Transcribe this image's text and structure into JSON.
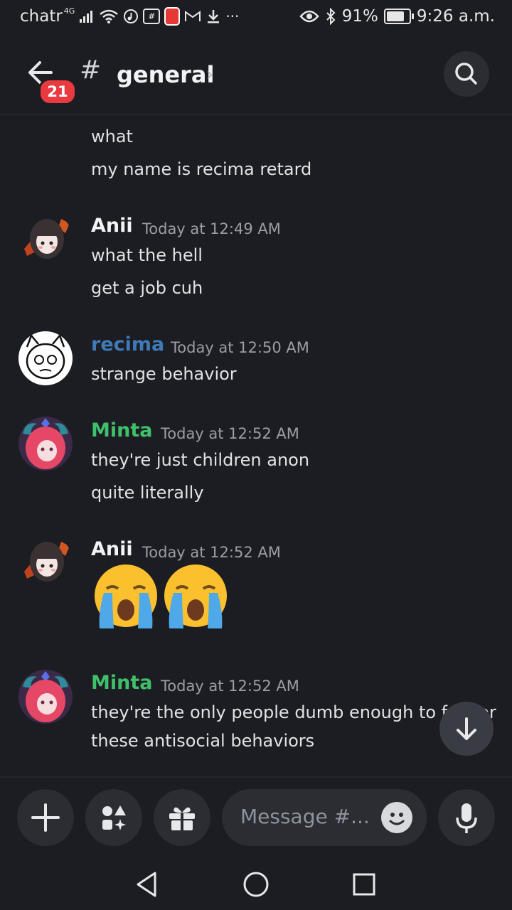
{
  "status_bar": {
    "carrier": "chatr",
    "network": "4G",
    "battery_percent": "91%",
    "battery_level": 0.91,
    "time": "9:26 a.m.",
    "icons": [
      "signal-icon",
      "wifi-icon",
      "music-icon",
      "hash-notif-icon",
      "app-notif-icon",
      "gmail-icon",
      "download-icon",
      "more-icon",
      "eye-icon",
      "bluetooth-icon",
      "battery-icon"
    ]
  },
  "header": {
    "back_badge": "21",
    "channel_hash": "#",
    "channel_name": "general",
    "chevron": "›"
  },
  "messages": [
    {
      "author": "",
      "time": "",
      "lines": [
        "what",
        "my name is recima retard"
      ]
    },
    {
      "author": "Anii",
      "author_color": "#f2f3f5",
      "time": "Today at 12:49 AM",
      "lines": [
        "what the hell",
        "get a job cuh"
      ]
    },
    {
      "author": "recima",
      "author_color": "#3f7ab8",
      "time": "Today at 12:50 AM",
      "lines": [
        "strange behavior"
      ]
    },
    {
      "author": "Minta",
      "author_color": "#3fc06a",
      "time": "Today at 12:52 AM",
      "lines": [
        "they're just children anon",
        "quite literally"
      ]
    },
    {
      "author": "Anii",
      "author_color": "#f2f3f5",
      "time": "Today at 12:52 AM",
      "lines": [],
      "emojis": [
        "loudly-crying-face-emoji",
        "loudly-crying-face-emoji"
      ]
    },
    {
      "author": "Minta",
      "author_color": "#3fc06a",
      "time": "Today at 12:52 AM",
      "lines": [
        "they're the only people dumb enough to fall for",
        "these antisocial behaviors"
      ]
    }
  ],
  "composer": {
    "placeholder": "Message #..."
  },
  "colors": {
    "background": "#1c1d22",
    "surface": "#2b2d33",
    "badge": "#e93a40",
    "recima": "#3f7ab8",
    "minta": "#3fc06a"
  }
}
